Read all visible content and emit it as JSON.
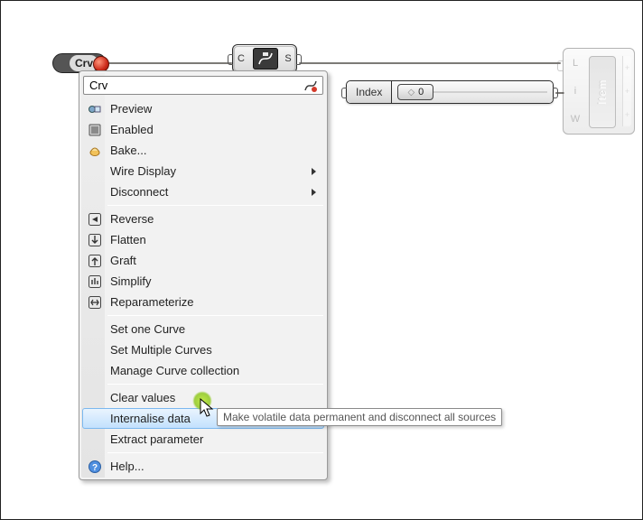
{
  "canvas": {
    "crv_param_label": "Crv",
    "mid_component": {
      "input_port": "C",
      "output_port": "S"
    },
    "index_slider": {
      "label": "Index",
      "value": "0"
    },
    "list_item_component": {
      "title": "Item",
      "inputs": [
        "L",
        "i",
        "W"
      ]
    }
  },
  "menu": {
    "search_value": "Crv",
    "groups": [
      {
        "items": [
          {
            "key": "preview",
            "label": "Preview",
            "icon": "preview-icon"
          },
          {
            "key": "enabled",
            "label": "Enabled",
            "icon": "enabled-icon"
          },
          {
            "key": "bake",
            "label": "Bake...",
            "icon": "bake-icon"
          },
          {
            "key": "wiredisplay",
            "label": "Wire Display",
            "submenu": true
          },
          {
            "key": "disconnect",
            "label": "Disconnect",
            "submenu": true
          }
        ]
      },
      {
        "items": [
          {
            "key": "reverse",
            "label": "Reverse",
            "icon": "reverse-icon"
          },
          {
            "key": "flatten",
            "label": "Flatten",
            "icon": "flatten-icon"
          },
          {
            "key": "graft",
            "label": "Graft",
            "icon": "graft-icon"
          },
          {
            "key": "simplify",
            "label": "Simplify",
            "icon": "simplify-icon"
          },
          {
            "key": "reparam",
            "label": "Reparameterize",
            "icon": "reparam-icon"
          }
        ]
      },
      {
        "items": [
          {
            "key": "setone",
            "label": "Set one Curve"
          },
          {
            "key": "setmulti",
            "label": "Set Multiple Curves"
          },
          {
            "key": "managecoll",
            "label": "Manage Curve collection"
          }
        ]
      },
      {
        "items": [
          {
            "key": "clear",
            "label": "Clear values"
          },
          {
            "key": "internalise",
            "label": "Internalise data",
            "highlight": true
          },
          {
            "key": "extract",
            "label": "Extract parameter"
          }
        ]
      },
      {
        "items": [
          {
            "key": "help",
            "label": "Help...",
            "icon": "help-icon"
          }
        ]
      }
    ]
  },
  "tooltip_text": "Make volatile data permanent and disconnect all sources"
}
